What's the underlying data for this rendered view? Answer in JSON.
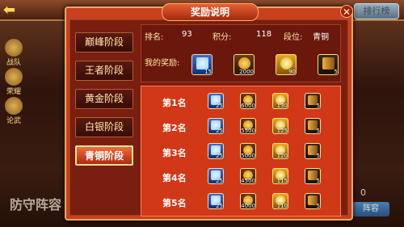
{
  "header": {
    "back_icon": "back-arrow-icon",
    "rank_button": "排行榜"
  },
  "sidebar": [
    {
      "label": "战队"
    },
    {
      "label": "荣耀"
    },
    {
      "label": "论武"
    }
  ],
  "background": {
    "bottom_left": "防守阵容",
    "bottom_right": "阵容",
    "zero": "0"
  },
  "dialog": {
    "title": "奖励说明",
    "tabs": [
      {
        "label": "巅峰阶段"
      },
      {
        "label": "王者阶段"
      },
      {
        "label": "黄金阶段"
      },
      {
        "label": "白银阶段"
      },
      {
        "label": "青铜阶段"
      }
    ],
    "active_tab": 4,
    "info": {
      "rank_label": "排名:",
      "rank_value": "93",
      "score_label": "积分:",
      "score_value": "118",
      "tier_label": "段位:",
      "tier_value": "青铜",
      "my_reward_label": "我的奖励:",
      "my_rewards": [
        {
          "type": "gem",
          "count": "15"
        },
        {
          "type": "coin",
          "count": "2000"
        },
        {
          "type": "gold",
          "count": "90"
        },
        {
          "type": "scroll",
          "count": "5"
        }
      ]
    },
    "rows": [
      {
        "label": "第1名",
        "rewards": [
          {
            "type": "gem",
            "count": "25"
          },
          {
            "type": "coin",
            "count": "6000"
          },
          {
            "type": "gold",
            "count": "130"
          },
          {
            "type": "scroll",
            "count": "5"
          }
        ]
      },
      {
        "label": "第2名",
        "rewards": [
          {
            "type": "gem",
            "count": "25"
          },
          {
            "type": "coin",
            "count": "5500"
          },
          {
            "type": "gold",
            "count": "125"
          },
          {
            "type": "scroll",
            "count": "5"
          }
        ]
      },
      {
        "label": "第3名",
        "rewards": [
          {
            "type": "gem",
            "count": "25"
          },
          {
            "type": "coin",
            "count": "5000"
          },
          {
            "type": "gold",
            "count": "120"
          },
          {
            "type": "scroll",
            "count": "5"
          }
        ]
      },
      {
        "label": "第4名",
        "rewards": [
          {
            "type": "gem",
            "count": "25"
          },
          {
            "type": "coin",
            "count": "4500"
          },
          {
            "type": "gold",
            "count": "115"
          },
          {
            "type": "scroll",
            "count": "5"
          }
        ]
      },
      {
        "label": "第5名",
        "rewards": [
          {
            "type": "gem",
            "count": "25"
          },
          {
            "type": "coin",
            "count": "4000"
          },
          {
            "type": "gold",
            "count": "110"
          },
          {
            "type": "scroll",
            "count": "5"
          }
        ]
      }
    ]
  }
}
